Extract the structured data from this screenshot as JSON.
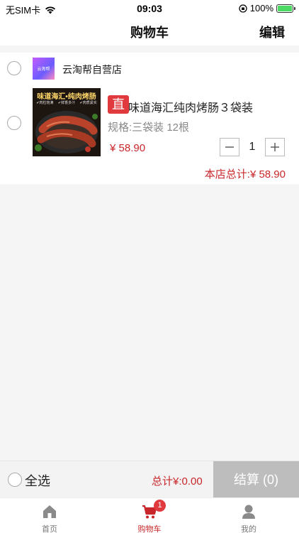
{
  "status_bar": {
    "carrier": "无SIM卡",
    "time": "09:03",
    "battery": "100%"
  },
  "nav": {
    "title": "购物车",
    "edit": "编辑"
  },
  "shop": {
    "logo_text": "云淘帮",
    "name": "云淘帮自营店",
    "total": "本店总计:¥ 58.90",
    "product": {
      "badge": "直",
      "name": "味道海汇纯肉烤肠３袋装",
      "spec": "规格:三袋装 12根",
      "price": "¥ 58.90",
      "quantity": "1",
      "image_title": "味道海汇•纯肉烤肠",
      "image_tags": [
        "✔肉粒饱满",
        "✔鲜香多汁",
        "✔肉质紧实"
      ]
    }
  },
  "checkout": {
    "select_all": "全选",
    "total": "总计¥:0.00",
    "button": "结算 (0)"
  },
  "tabs": [
    {
      "label": "首页",
      "icon": "home-icon"
    },
    {
      "label": "购物车",
      "icon": "cart-icon",
      "badge": "1",
      "active": true
    },
    {
      "label": "我的",
      "icon": "profile-icon"
    }
  ],
  "colors": {
    "accent": "#c8262a",
    "badge": "#e0393e",
    "checkout_disabled": "#bdbdbd"
  }
}
